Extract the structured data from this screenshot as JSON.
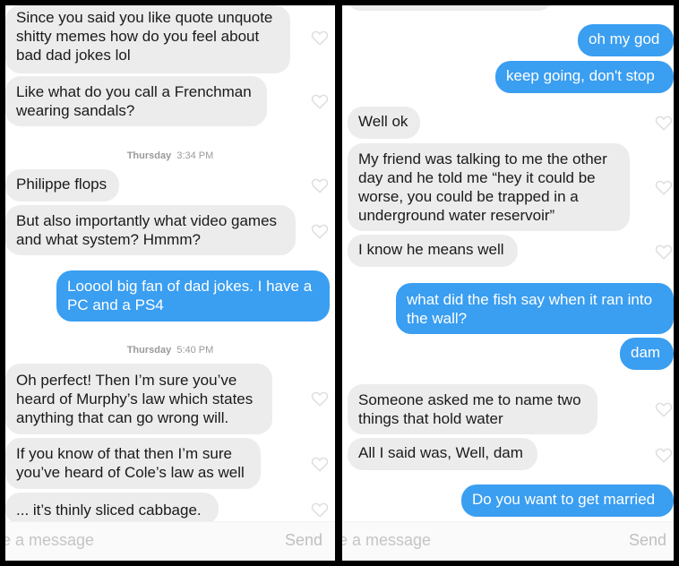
{
  "icons": {
    "heart": "heart-outline-icon"
  },
  "colors": {
    "incoming": "#ececed",
    "outgoing": "#3a9ef1",
    "heart": "#dcdcdc"
  },
  "left": {
    "messages": [
      {
        "text": "Since you said you like quote unquote\nshitty memes how do you feel about\nbad dad jokes lol"
      },
      {
        "text": "Like what do you call a Frenchman\nwearing sandals?"
      },
      {
        "text": "Philippe flops"
      },
      {
        "text": "But also importantly what video games\nand what system? Hmmm?"
      },
      {
        "text": "Looool big fan of dad jokes. I have a\nPC and a PS4"
      },
      {
        "text": "Oh perfect! Then I’m sure you’ve\nheard of Murphy’s law which states\nanything that can go wrong will."
      },
      {
        "text": "If you know of that then I’m sure\nyou’ve heard of Cole’s law as well"
      },
      {
        "text": "... it’s thinly sliced cabbage."
      }
    ],
    "timestamps": [
      {
        "day": "Thursday",
        "time": "3:34 PM"
      },
      {
        "day": "Thursday",
        "time": "5:40 PM"
      }
    ],
    "composer": {
      "placeholder": "e a message",
      "send": "Send"
    }
  },
  "right": {
    "messages": [
      {
        "text": "oh my god"
      },
      {
        "text": "keep going, don't stop"
      },
      {
        "text": "Well ok"
      },
      {
        "text": "My friend was talking to me the other\nday and he told me “hey it could be\nworse, you could be trapped in a\nunderground water reservoir”"
      },
      {
        "text": "I know he means well"
      },
      {
        "text": "what did the fish say when it ran into\nthe wall?"
      },
      {
        "text": "dam"
      },
      {
        "text": "Someone asked me to name two\nthings that hold water"
      },
      {
        "text": "All I said was, Well, dam"
      },
      {
        "text": "Do you want to get married"
      }
    ],
    "composer": {
      "placeholder": "e a message",
      "send": "Send"
    }
  }
}
